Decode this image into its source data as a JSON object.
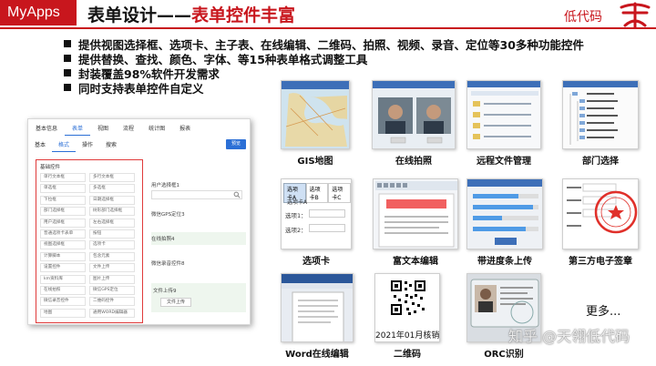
{
  "header": {
    "brand": "MyApps",
    "title_black": "表单设计——",
    "title_red": "表单控件丰富",
    "right_label": "低代码",
    "logo_text": "天翎"
  },
  "bullets": [
    "提供视图选择框、选项卡、主子表、在线编辑、二维码、拍照、视频、录音、定位等30多种功能控件",
    "提供替换、查找、颜色、字体、等15种表单格式调整工具",
    "封装覆盖98%软件开发需求",
    "同时支持表单控件自定义"
  ],
  "designer": {
    "top_tabs": [
      "基本信息",
      "表单",
      "视图",
      "流程",
      "统计图",
      "报表"
    ],
    "sub_tabs": [
      "基本",
      "格式",
      "操作",
      "搜索"
    ],
    "preview": "预览",
    "controls_header": "基础控件",
    "controls": [
      "单行文本框",
      "多行文本框",
      "单选框",
      "多选框",
      "下拉框",
      "日期选择框",
      "部门选择框",
      "树形部门选择框",
      "用户选择框",
      "左右选择框",
      "普通选项卡表单",
      "按钮",
      "视图选择框",
      "选项卡",
      "计算脚本",
      "包含元素",
      "设置控件",
      "文件上传",
      "km资料库",
      "图片上传",
      "在线拍照",
      "微信GPS定位",
      "微信录音控件",
      "二维码控件",
      "地图",
      "通用WORD编辑器"
    ],
    "form_fields": {
      "user_select": "用户选择框1",
      "gps": "微信GPS定位3",
      "photo": "在线拍照4",
      "audio": "微信录音控件8",
      "file": "文件上传9",
      "file_button": "文件上传"
    }
  },
  "thumbnails": [
    {
      "label": "GIS地图"
    },
    {
      "label": "在线拍照"
    },
    {
      "label": "远程文件管理"
    },
    {
      "label": "部门选择"
    },
    {
      "label": "选项卡"
    },
    {
      "label": "富文本编辑"
    },
    {
      "label": "带进度条上传"
    },
    {
      "label": "第三方电子签章"
    },
    {
      "label": "Word在线编辑"
    },
    {
      "label": "二维码"
    },
    {
      "label": "ORC识别"
    }
  ],
  "thumb_texts": {
    "tabs": [
      "选项卡A",
      "选项卡B",
      "选项卡C"
    ],
    "tab_inner": "选项卡A",
    "option1": "选项1：",
    "option2": "选项2：",
    "qr_caption": "2021年01月核销单"
  },
  "more": "更多...",
  "watermark": "知乎 @天翎低代码"
}
